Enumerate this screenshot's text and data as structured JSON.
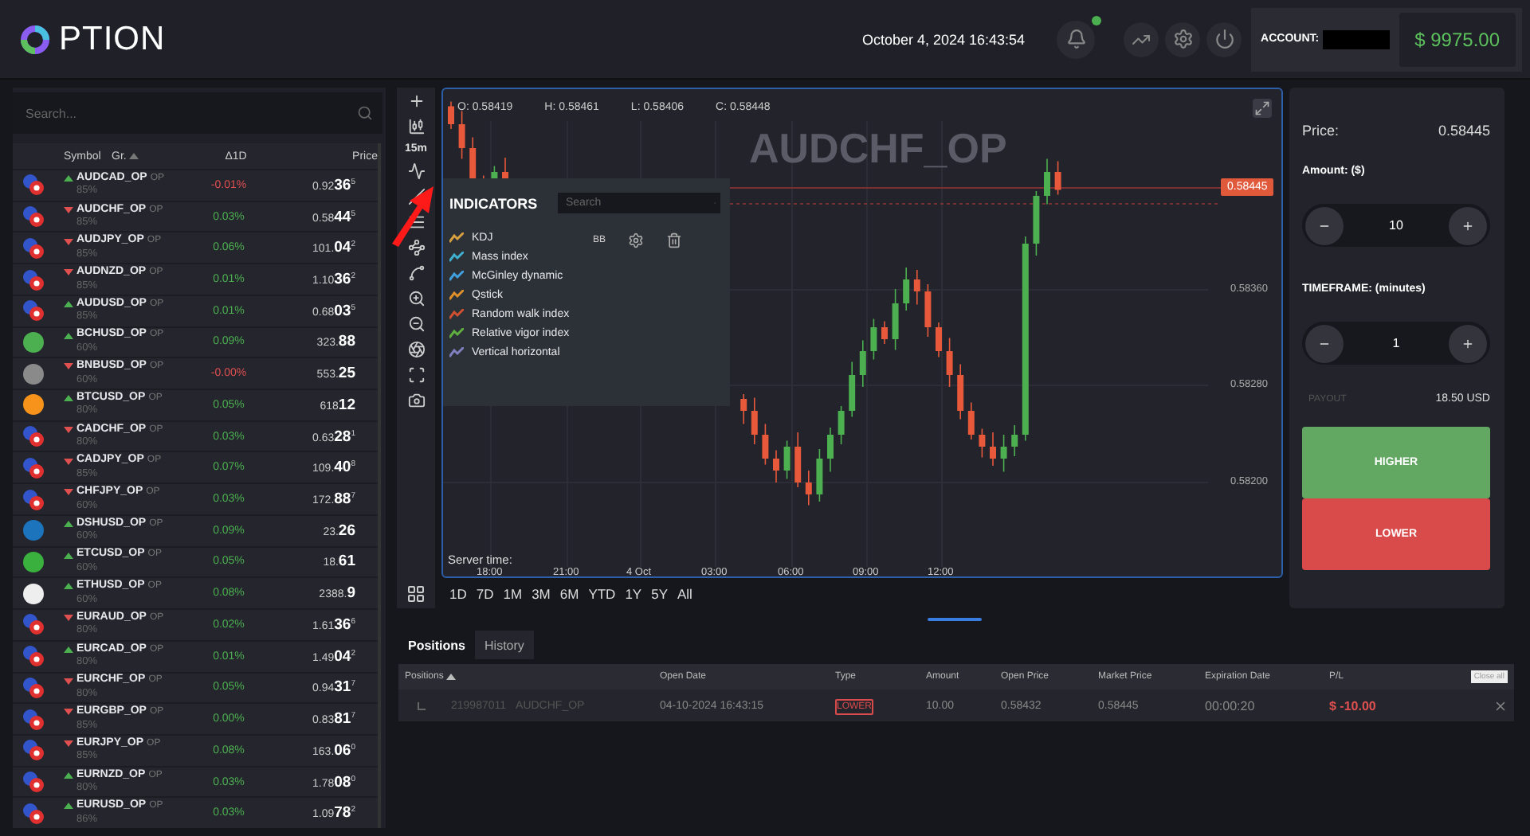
{
  "header": {
    "logo": "PTION",
    "datetime": "October 4, 2024 16:43:54",
    "notifications": {
      "unread": true
    },
    "account_label": "ACCOUNT:",
    "balance": "$ 9975.00"
  },
  "watchlist": {
    "search_placeholder": "Search...",
    "columns": [
      {
        "label": "Symbol",
        "sorted": false
      },
      {
        "label": "Gr.",
        "sorted": true
      },
      {
        "label": "Δ1D",
        "sorted": false
      },
      {
        "label": "Price",
        "sorted": false
      }
    ],
    "rows": [
      {
        "symbol": "AUDCAD_OP",
        "market": "OP",
        "payout": "85%",
        "rising": true,
        "change": "-0.01%",
        "negative": true,
        "price": "0.92**36**$^{5}$",
        "kind": "forex"
      },
      {
        "symbol": "AUDCHF_OP",
        "market": "OP",
        "payout": "85%",
        "rising": false,
        "change": "0.03%",
        "negative": false,
        "price": "0.58**44**$^{5}$",
        "kind": "forex"
      },
      {
        "symbol": "AUDJPY_OP",
        "market": "OP",
        "payout": "85%",
        "rising": false,
        "change": "0.06%",
        "negative": false,
        "price": "101.**04**$^{2}$",
        "kind": "forex"
      },
      {
        "symbol": "AUDNZD_OP",
        "market": "OP",
        "payout": "85%",
        "rising": false,
        "change": "0.01%",
        "negative": false,
        "price": "1.10**36**$^{2}$",
        "kind": "forex"
      },
      {
        "symbol": "AUDUSD_OP",
        "market": "OP",
        "payout": "85%",
        "rising": true,
        "change": "0.01%",
        "negative": false,
        "price": "0.68**03**$^{5}$",
        "kind": "forex"
      },
      {
        "symbol": "BCHUSD_OP",
        "market": "OP",
        "payout": "60%",
        "rising": true,
        "change": "0.09%",
        "negative": false,
        "price": "323.**88**",
        "kind": "crypto",
        "color": "#4caf50"
      },
      {
        "symbol": "BNBUSD_OP",
        "market": "OP",
        "payout": "60%",
        "rising": false,
        "change": "-0.00%",
        "negative": true,
        "price": "553.**25**",
        "kind": "crypto",
        "color": "#8a8a8a"
      },
      {
        "symbol": "BTCUSD_OP",
        "market": "OP",
        "payout": "80%",
        "rising": true,
        "change": "0.05%",
        "negative": false,
        "price": "618**12**",
        "kind": "crypto",
        "color": "#f7931a"
      },
      {
        "symbol": "CADCHF_OP",
        "market": "OP",
        "payout": "80%",
        "rising": false,
        "change": "0.03%",
        "negative": false,
        "price": "0.63**28**$^{1}$",
        "kind": "forex"
      },
      {
        "symbol": "CADJPY_OP",
        "market": "OP",
        "payout": "85%",
        "rising": false,
        "change": "0.07%",
        "negative": false,
        "price": "109.**40**$^{8}$",
        "kind": "forex"
      },
      {
        "symbol": "CHFJPY_OP",
        "market": "OP",
        "payout": "60%",
        "rising": false,
        "change": "0.03%",
        "negative": false,
        "price": "172.**88**$^{7}$",
        "kind": "forex"
      },
      {
        "symbol": "DSHUSD_OP",
        "market": "OP",
        "payout": "60%",
        "rising": true,
        "change": "0.09%",
        "negative": false,
        "price": "23.**26**",
        "kind": "crypto",
        "color": "#1c75bc"
      },
      {
        "symbol": "ETCUSD_OP",
        "market": "OP",
        "payout": "60%",
        "rising": true,
        "change": "0.05%",
        "negative": false,
        "price": "18.**61**",
        "kind": "crypto",
        "color": "#3ab03e"
      },
      {
        "symbol": "ETHUSD_OP",
        "market": "OP",
        "payout": "60%",
        "rising": true,
        "change": "0.08%",
        "negative": false,
        "price": "2388.**9**",
        "kind": "crypto",
        "color": "#eeeeee"
      },
      {
        "symbol": "EURAUD_OP",
        "market": "OP",
        "payout": "80%",
        "rising": false,
        "change": "0.02%",
        "negative": false,
        "price": "1.61**36**$^{6}$",
        "kind": "forex"
      },
      {
        "symbol": "EURCAD_OP",
        "market": "OP",
        "payout": "80%",
        "rising": true,
        "change": "0.01%",
        "negative": false,
        "price": "1.49**04**$^{2}$",
        "kind": "forex"
      },
      {
        "symbol": "EURCHF_OP",
        "market": "OP",
        "payout": "80%",
        "rising": false,
        "change": "0.05%",
        "negative": false,
        "price": "0.94**31**$^{7}$",
        "kind": "forex"
      },
      {
        "symbol": "EURGBP_OP",
        "market": "OP",
        "payout": "85%",
        "rising": false,
        "change": "0.00%",
        "negative": false,
        "price": "0.83**81**$^{7}$",
        "kind": "forex"
      },
      {
        "symbol": "EURJPY_OP",
        "market": "OP",
        "payout": "85%",
        "rising": false,
        "change": "0.08%",
        "negative": false,
        "price": "163.**06**$^{0}$",
        "kind": "forex"
      },
      {
        "symbol": "EURNZD_OP",
        "market": "OP",
        "payout": "80%",
        "rising": true,
        "change": "0.03%",
        "negative": false,
        "price": "1.78**08**$^{0}$",
        "kind": "forex"
      },
      {
        "symbol": "EURUSD_OP",
        "market": "OP",
        "payout": "86%",
        "rising": true,
        "change": "0.03%",
        "negative": false,
        "price": "1.09**78**$^{2}$",
        "kind": "forex"
      }
    ]
  },
  "toolbar": {
    "interval": "15m"
  },
  "chart": {
    "ohlc": [
      {
        "label": "O:",
        "value": "0.58419"
      },
      {
        "label": "H:",
        "value": "0.58461"
      },
      {
        "label": "L:",
        "value": "0.58406"
      },
      {
        "label": "C:",
        "value": "0.58448"
      }
    ],
    "current_price": "0.58445",
    "price_labels": [
      "0.58360",
      "0.58280",
      "0.58200"
    ],
    "time_labels": [
      "18:00",
      "21:00",
      "4 Oct",
      "03:00",
      "06:00",
      "09:00",
      "12:00"
    ],
    "server_time_label": "Server time:",
    "watermark": "AUDCHF_OP",
    "ranges": [
      "1D",
      "7D",
      "1M",
      "3M",
      "6M",
      "YTD",
      "1Y",
      "5Y",
      "All"
    ]
  },
  "indicators": {
    "title": "INDICATORS",
    "search_placeholder": "Search",
    "active": "BB",
    "items": [
      {
        "name": "KDJ",
        "color": "#d9a040"
      },
      {
        "name": "Mass index",
        "color": "#40b0d0"
      },
      {
        "name": "McGinley dynamic",
        "color": "#40a0e0"
      },
      {
        "name": "Qstick",
        "color": "#e0902a"
      },
      {
        "name": "Random walk index",
        "color": "#d05030"
      },
      {
        "name": "Relative vigor index",
        "color": "#60b040"
      },
      {
        "name": "Vertical horizontal",
        "color": "#8080c0"
      }
    ]
  },
  "trade": {
    "price_label": "Price:",
    "price": "0.58445",
    "amount_label": "Amount: ($)",
    "amount": "10",
    "timeframe_label": "TIMEFRAME: (minutes)",
    "timeframe": "1",
    "payout_label": "PAYOUT",
    "payout": "18.50 USD",
    "buttons": [
      {
        "label": "HIGHER",
        "kind": "higher"
      },
      {
        "label": "LOWER",
        "kind": "lower"
      }
    ]
  },
  "positions": {
    "tabs": [
      {
        "label": "Positions",
        "selected": true
      },
      {
        "label": "History",
        "selected": false
      }
    ],
    "columns": [
      {
        "label": "Positions",
        "sorted": true
      },
      {
        "label": "Open Date",
        "sorted": false
      },
      {
        "label": "Type",
        "sorted": false
      },
      {
        "label": "Amount",
        "sorted": false
      },
      {
        "label": "Open Price",
        "sorted": false
      },
      {
        "label": "Market Price",
        "sorted": false
      },
      {
        "label": "Expiration Date",
        "sorted": false
      },
      {
        "label": "P/L",
        "sorted": false
      }
    ],
    "close_all": "Close all",
    "rows": [
      {
        "id": "219987011",
        "symbol": "AUDCHF_OP",
        "open_date": "04-10-2024 16:43:15",
        "type": "LOWER",
        "kind": "lower",
        "amount": "10.00",
        "open_price": "0.58432",
        "market_price": "0.58445",
        "expiration": "00:00:20",
        "pl": "$ -10.00",
        "pl_negative": true
      }
    ]
  }
}
